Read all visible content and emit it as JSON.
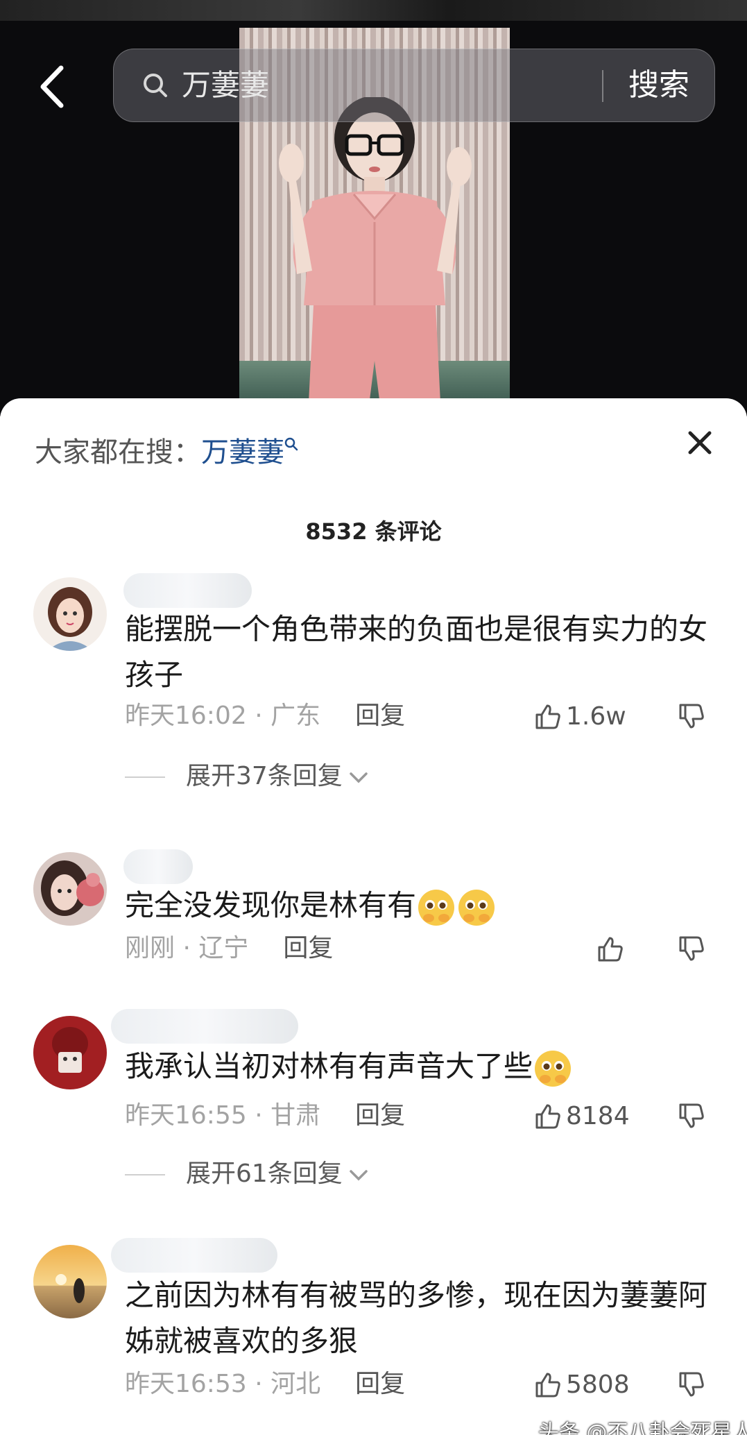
{
  "search": {
    "query": "万萋萋",
    "button": "搜索"
  },
  "trending": {
    "prefix": "大家都在搜：",
    "term": "万萋萋"
  },
  "comments_count": "8532 条评论",
  "comments": [
    {
      "text": "能摆脱一个角色带来的负面也是很有实力的女孩子",
      "time": "昨天16:02",
      "location": "广东",
      "reply": "回复",
      "likes": "1.6w",
      "expand": "展开37条回复"
    },
    {
      "text": "完全没发现你是林有有",
      "time": "刚刚",
      "location": "辽宁",
      "reply": "回复",
      "likes": ""
    },
    {
      "text": "我承认当初对林有有声音大了些",
      "time": "昨天16:55",
      "location": "甘肃",
      "reply": "回复",
      "likes": "8184",
      "expand": "展开61条回复"
    },
    {
      "text": "之前因为林有有被骂的多惨，现在因为萋萋阿姊就被喜欢的多狠",
      "time": "昨天16:53",
      "location": "河北",
      "reply": "回复",
      "likes": "5808"
    }
  ],
  "watermark": "头条 @不八卦会死星人",
  "colors": {
    "accent_link": "#1f4f8f",
    "meta_gray": "#a3a3a3"
  },
  "icons": [
    "back-chevron-icon",
    "search-icon",
    "close-icon",
    "thumbs-up-icon",
    "thumbs-down-icon",
    "chevron-down-icon",
    "pleading-face-emoji"
  ]
}
